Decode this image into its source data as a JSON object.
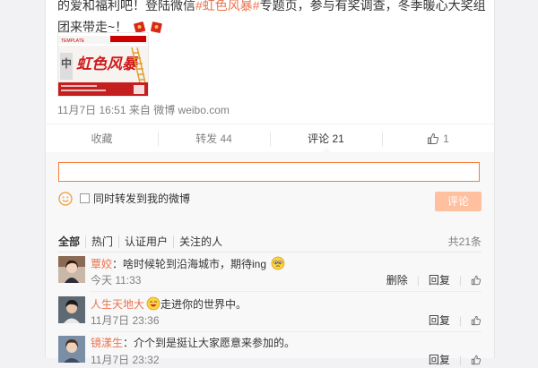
{
  "post": {
    "text_before": "的爱和福利吧！登陆微信",
    "tag": "#虹色风暴#",
    "text_after": "专题页，参与有奖调查，冬季暖心大奖组团来带走~！",
    "thumbnail_title": "虹色风暴",
    "time": "11月7日 16:51",
    "source_prefix": "来自",
    "source": "微博 weibo.com"
  },
  "actions": {
    "favorite": "收藏",
    "repost": "转发 44",
    "comment": "评论 21",
    "like": "1"
  },
  "composer": {
    "input_value": "",
    "input_placeholder": "",
    "repost_label": "同时转发到我的微博",
    "submit_label": "评论"
  },
  "filters": {
    "items": [
      "全部",
      "热门",
      "认证用户",
      "关注的人"
    ],
    "total": "共21条"
  },
  "comments": [
    {
      "user": "覃姣",
      "text": "：啥时候轮到沿海城市，期待ing",
      "time": "今天 11:33",
      "delete": "删除",
      "reply": "回复"
    },
    {
      "user": "人生天地大",
      "text": "走进你的世界中。",
      "time": "11月7日 23:36",
      "reply": "回复"
    },
    {
      "user": "镜漾生",
      "text": "：介个到是挺让大家愿意来参加的。",
      "time": "11月7日 23:32",
      "reply": "回复"
    }
  ],
  "colors": {
    "accent": "#eb7350",
    "input_border": "#fa7d3c",
    "submit_disabled": "#ffc09f",
    "meta": "#808080"
  }
}
